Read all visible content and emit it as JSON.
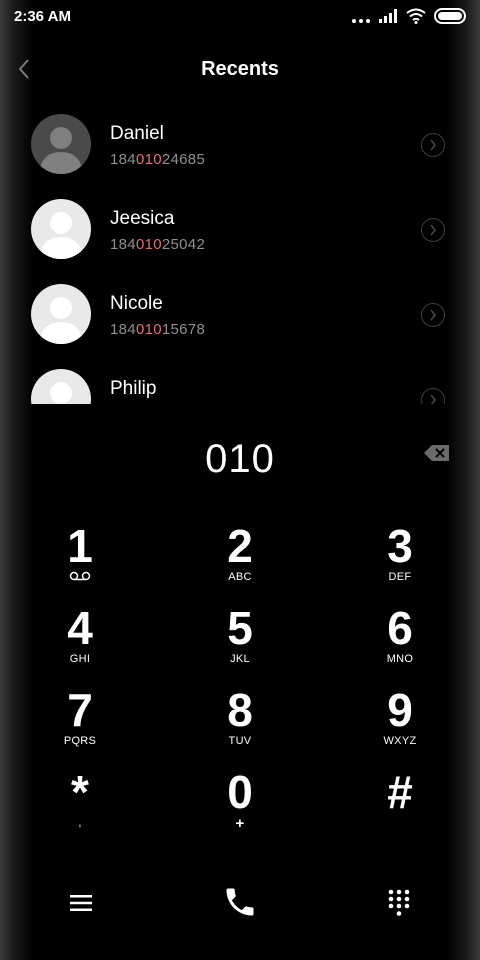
{
  "status_bar": {
    "time": "2:36 AM"
  },
  "header": {
    "title": "Recents",
    "back_icon": "chevron-left-icon"
  },
  "recents": [
    {
      "name": "Daniel",
      "number_prefix": "184",
      "number_match": "010",
      "number_suffix": "24685",
      "avatar_style": "dark"
    },
    {
      "name": "Jeesica",
      "number_prefix": "184",
      "number_match": "010",
      "number_suffix": "25042",
      "avatar_style": "light"
    },
    {
      "name": "Nicole",
      "number_prefix": "184",
      "number_match": "010",
      "number_suffix": "15678",
      "avatar_style": "light"
    },
    {
      "name": "Philip",
      "number_prefix": "",
      "number_match": "",
      "number_suffix": "",
      "avatar_style": "light"
    }
  ],
  "dialer": {
    "number": "010"
  },
  "keypad": [
    {
      "digit": "1",
      "letters": ""
    },
    {
      "digit": "2",
      "letters": "ABC"
    },
    {
      "digit": "3",
      "letters": "DEF"
    },
    {
      "digit": "4",
      "letters": "GHI"
    },
    {
      "digit": "5",
      "letters": "JKL"
    },
    {
      "digit": "6",
      "letters": "MNO"
    },
    {
      "digit": "7",
      "letters": "PQRS"
    },
    {
      "digit": "8",
      "letters": "TUV"
    },
    {
      "digit": "9",
      "letters": "WXYZ"
    },
    {
      "digit": "*",
      "letters": ","
    },
    {
      "digit": "0",
      "letters": "+"
    },
    {
      "digit": "#",
      "letters": ""
    }
  ],
  "colors": {
    "background": "#000000",
    "match_highlight": "#e0707a",
    "secondary_text": "#8f8f8f"
  }
}
